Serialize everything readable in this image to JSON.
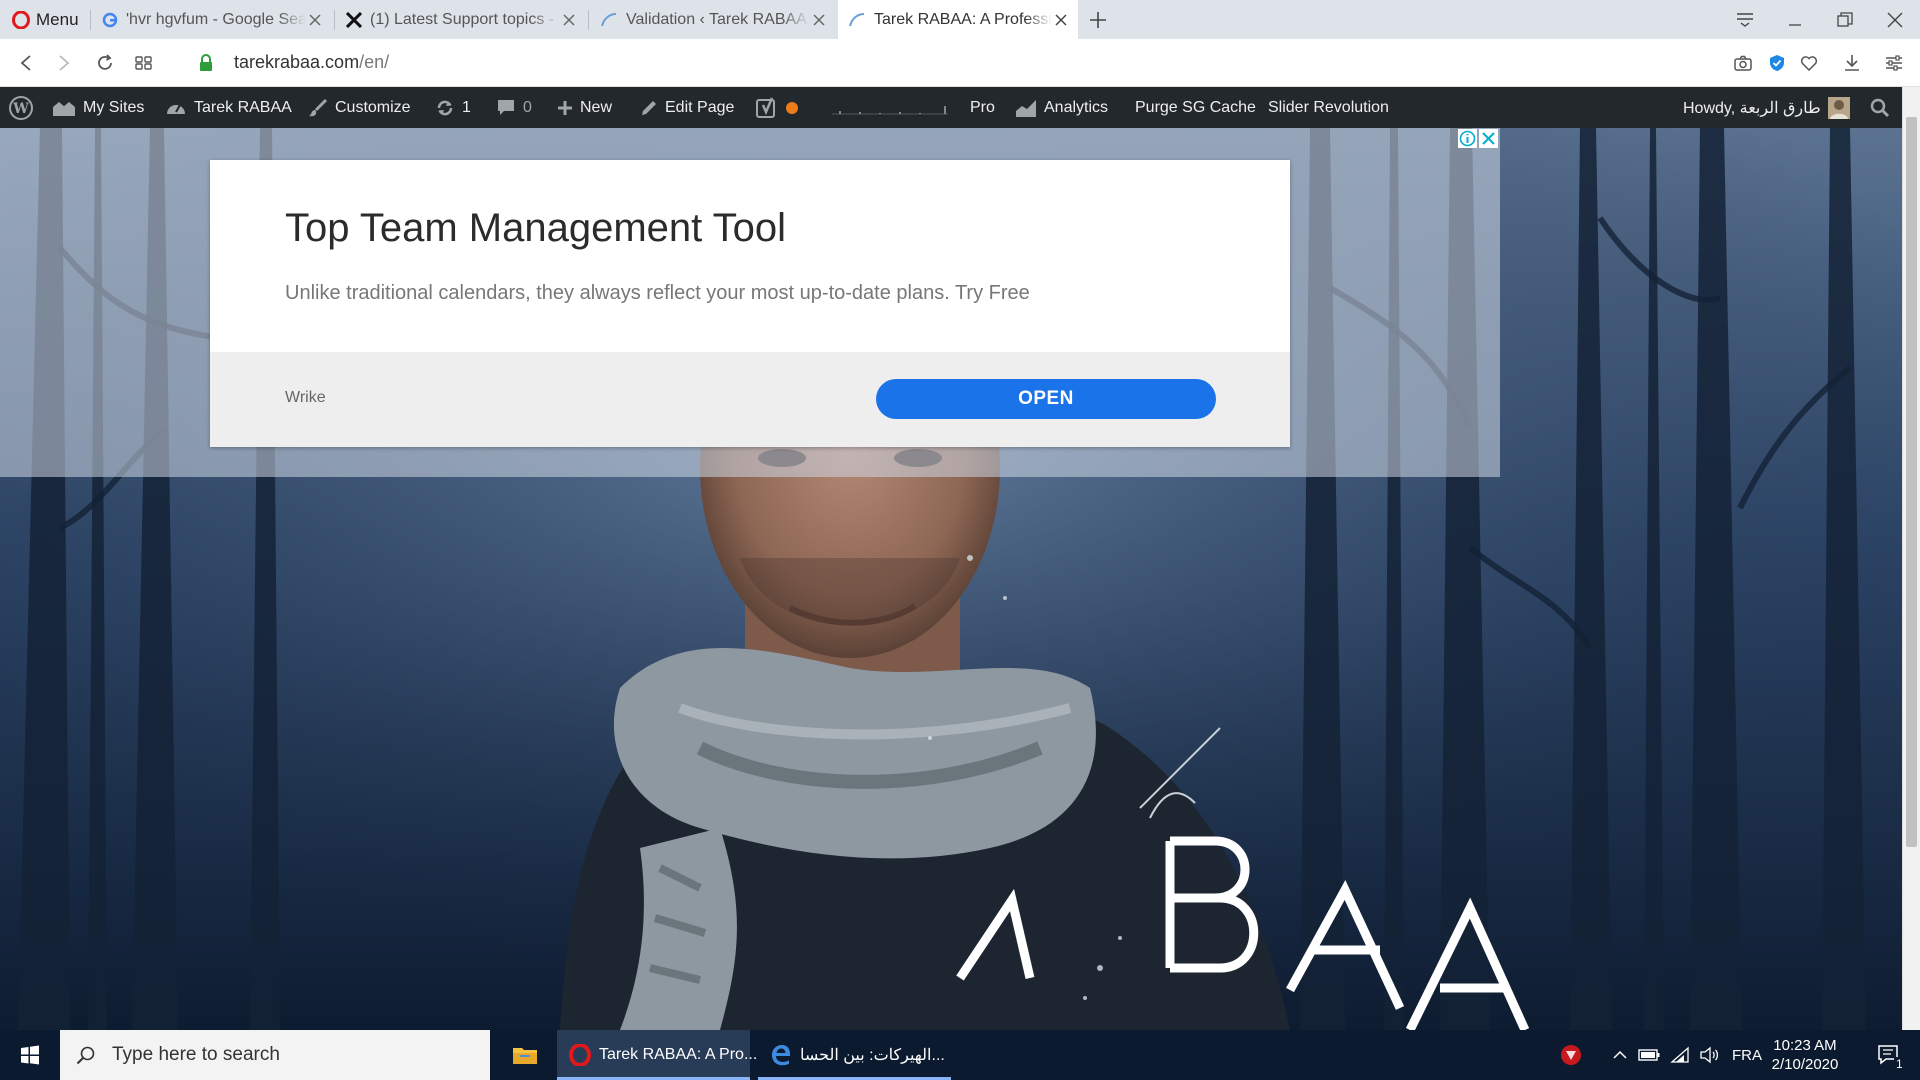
{
  "browser": {
    "menu_label": "Menu",
    "tabs": [
      {
        "title": "'hvr hgvfum - Google Search"
      },
      {
        "title": "(1) Latest Support topics - "
      },
      {
        "title": "Validation ‹ Tarek RABAA — "
      },
      {
        "title": "Tarek RABAA: A Professional"
      }
    ],
    "url_domain": "tarekrabaa.com",
    "url_path": "/en/"
  },
  "wp_admin_bar": {
    "my_sites": "My Sites",
    "site_name": "Tarek RABAA",
    "customize": "Customize",
    "updates_count": "1",
    "comments_count": "0",
    "new": "New",
    "edit_page": "Edit Page",
    "pro": "Pro",
    "analytics": "Analytics",
    "purge_cache": "Purge SG Cache",
    "slider_revolution": "Slider Revolution",
    "howdy": "Howdy, طارق الربعة"
  },
  "ad": {
    "headline": "Top Team Management Tool",
    "description": "Unlike traditional calendars, they always reflect your most up-to-date plans. Try Free",
    "brand": "Wrike",
    "cta": "OPEN"
  },
  "hero": {
    "overlay_letters": [
      "A",
      "B",
      "A",
      "A"
    ]
  },
  "taskbar": {
    "search_placeholder": "Type here to search",
    "apps": [
      {
        "label": "Tarek RABAA: A Pro..."
      },
      {
        "label": "الهيركات: بين الحسا..."
      }
    ],
    "language": "FRA",
    "time": "10:23 AM",
    "date": "2/10/2020",
    "notification_count": "1"
  },
  "colors": {
    "wp_bar": "#23282d",
    "ad_button": "#1a73e8",
    "taskbar": "#0b1a2e",
    "opera_red": "#e0191c"
  }
}
